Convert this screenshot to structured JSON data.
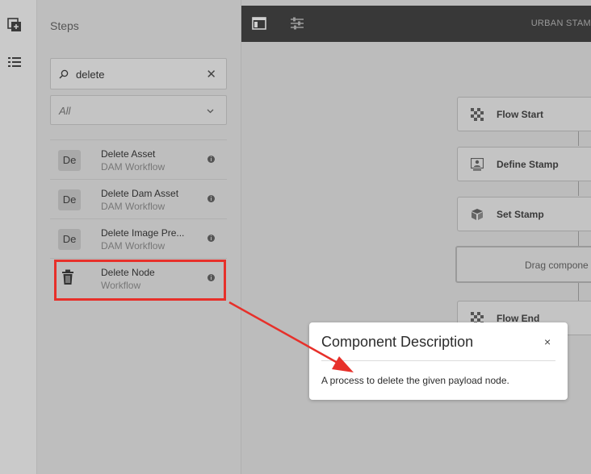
{
  "panel": {
    "title": "Steps",
    "search_value": "delete",
    "filter_value": "All",
    "items": [
      {
        "badge": "De",
        "name": "Delete Asset",
        "sub": "DAM Workflow"
      },
      {
        "badge": "De",
        "name": "Delete Dam Asset",
        "sub": "DAM Workflow"
      },
      {
        "badge": "De",
        "name": "Delete Image Pre...",
        "sub": "DAM Workflow"
      },
      {
        "badge": "",
        "name": "Delete Node",
        "sub": "Workflow"
      }
    ]
  },
  "topbar": {
    "title": "URBAN STAM"
  },
  "canvas": {
    "nodes": [
      {
        "label": "Flow Start",
        "icon": "flow-start-icon"
      },
      {
        "label": "Define Stamp",
        "icon": "define-stamp-icon"
      },
      {
        "label": "Set Stamp",
        "icon": "set-stamp-icon"
      },
      {
        "label": "Flow End",
        "icon": "flow-end-icon"
      }
    ],
    "drop_zone_label": "Drag compone"
  },
  "popover": {
    "title": "Component Description",
    "close_symbol": "×",
    "description": "A process to delete the given payload node."
  },
  "annotation_color": "#e7302a"
}
